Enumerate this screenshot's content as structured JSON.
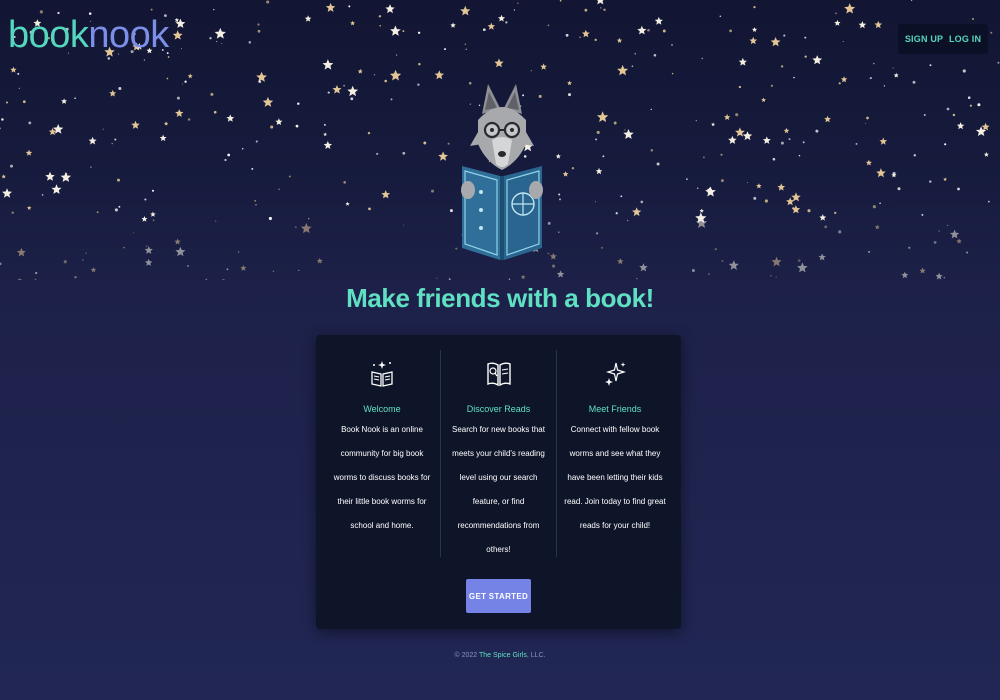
{
  "header": {
    "logo_part1": "book",
    "logo_part2": "nook",
    "signup_label": "SIGN UP",
    "login_label": "LOG IN"
  },
  "hero": {
    "mascot_icon": "wolf-reading-book-icon",
    "headline": "Make friends with a book!"
  },
  "features": [
    {
      "icon": "open-book-sparkle-icon",
      "title": "Welcome",
      "text": "Book Nook is an online community for big book worms to discuss books for their little book worms for school and home."
    },
    {
      "icon": "book-search-icon",
      "title": "Discover Reads",
      "text": "Search for new books that meets your child's reading level using our search feature, or find recommendations from others!"
    },
    {
      "icon": "sparkles-icon",
      "title": "Meet Friends",
      "text": "Connect with fellow book worms and see what they have been letting their kids read. Join today to find great reads for your child!"
    }
  ],
  "cta": {
    "label": "GET STARTED"
  },
  "footer": {
    "prefix": "© 2022",
    "brand": "The Spice Girls",
    "suffix": ", LLC."
  },
  "colors": {
    "accent": "#5fe0c3",
    "logo_second": "#7b8ee8",
    "button": "#7582e6",
    "card": "#0f1529",
    "background": "#1f2350"
  }
}
